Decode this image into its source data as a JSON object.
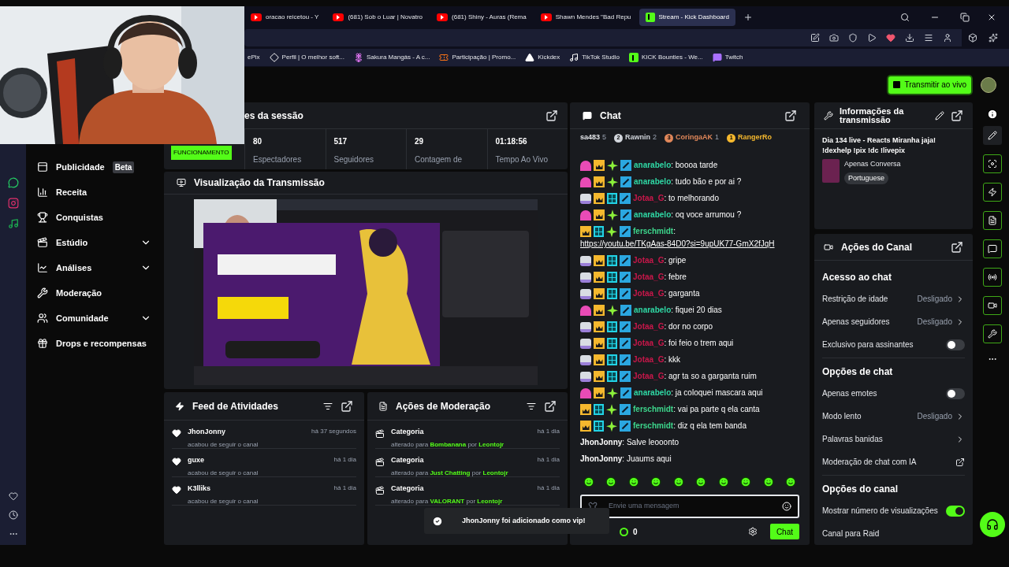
{
  "browser": {
    "tabs": [
      {
        "title": "oracao reicetou - Y",
        "kind": "youtube",
        "selected": false
      },
      {
        "title": "(681) Sob o Luar | Novatro",
        "kind": "youtube",
        "selected": false
      },
      {
        "title": "(681) Shiny - Auras (Rema",
        "kind": "youtube",
        "selected": false
      },
      {
        "title": "Shawn Mendes \"Bad Repu",
        "kind": "youtube",
        "selected": false
      },
      {
        "title": "Stream - Kick Dashboard",
        "kind": "kick",
        "selected": true
      }
    ],
    "bookmarks": [
      {
        "title": "ePix",
        "kind": "none"
      },
      {
        "title": "Perfil | O melhor soft...",
        "kind": "diamond"
      },
      {
        "title": "Sakura Mangás - A c...",
        "kind": "flower"
      },
      {
        "title": "Participação | Promo...",
        "kind": "ticket"
      },
      {
        "title": "Kickdex",
        "kind": "triangle"
      },
      {
        "title": "TikTok Studio",
        "kind": "tiktok"
      },
      {
        "title": "KICK Bounties - We...",
        "kind": "kick"
      },
      {
        "title": "Twitch",
        "kind": "twitch"
      }
    ]
  },
  "header": {
    "go_live_button": "Transmitir ao vivo"
  },
  "sidebar": {
    "items": [
      {
        "label": "Publicidade",
        "badge": "Beta",
        "expandable": false
      },
      {
        "label": "Receita",
        "expandable": false
      },
      {
        "label": "Conquistas",
        "expandable": false
      },
      {
        "label": "Estúdio",
        "expandable": true
      },
      {
        "label": "Análises",
        "expandable": true
      },
      {
        "label": "Moderação",
        "expandable": false
      },
      {
        "label": "Comunidade",
        "expandable": true
      },
      {
        "label": "Drops e recompensas",
        "expandable": false
      }
    ]
  },
  "session_stats": {
    "title": "es da sessão",
    "status_badge": "FUNCIONAMENTO",
    "stats": [
      {
        "value": "80",
        "label": "Espectadores"
      },
      {
        "value": "517",
        "label": "Seguidores"
      },
      {
        "value": "29",
        "label": "Contagem de"
      },
      {
        "value": "01:18:56",
        "label": "Tempo Ao Vivo"
      }
    ]
  },
  "preview": {
    "title": "Visualização da Transmissão"
  },
  "activity_feed": {
    "title": "Feed de Atividades",
    "items": [
      {
        "user": "JhonJonny",
        "action": "acabou de seguir o canal",
        "time": "há 37 segundos"
      },
      {
        "user": "guxe",
        "action": "acabou de seguir o canal",
        "time": "há 1 dia"
      },
      {
        "user": "K3lliks",
        "action": "acabou de seguir o canal",
        "time": "há 1 dia"
      }
    ]
  },
  "moderation_actions": {
    "title": "Ações de Moderação",
    "items": [
      {
        "title": "Categoria",
        "change": "alterado para",
        "category": "Bombanana",
        "by": "por",
        "moderator": "Leontojr",
        "time": "há 1 dia"
      },
      {
        "title": "Categoria",
        "change": "alterado para",
        "category": "Just Chatting",
        "by": "por",
        "moderator": "Leontojr",
        "time": "há 1 dia"
      },
      {
        "title": "Categoria",
        "change": "alterado para",
        "category": "VALORANT",
        "by": "por",
        "moderator": "Leontojr",
        "time": "há 1 dia"
      }
    ]
  },
  "chat": {
    "title": "Chat",
    "leaderboard": [
      {
        "name": "sa483",
        "count": "5"
      },
      {
        "rank": "2",
        "name": "Rawnin",
        "count": "2",
        "color": "#d1d5db"
      },
      {
        "rank": "3",
        "name": "CoringaAK",
        "count": "1",
        "color": "#e0875a"
      },
      {
        "rank": "1",
        "name": "RangerRo",
        "color": "#f5b82e"
      }
    ],
    "messages": [
      {
        "badges": [
          {
            "kind": "sub25"
          },
          {
            "kind": "founder"
          },
          {
            "kind": "vip"
          },
          {
            "kind": "mod"
          }
        ],
        "user": "anarabelo",
        "separator": ":",
        "color": "#2fd9a5",
        "text": "boooa tarde"
      },
      {
        "badges": [
          {
            "kind": "sub25"
          },
          {
            "kind": "founder"
          },
          {
            "kind": "vip"
          },
          {
            "kind": "mod"
          }
        ],
        "user": "anarabelo",
        "separator": ":",
        "color": "#2fd9a5",
        "text": "tudo bão e por ai ?"
      },
      {
        "badges": [
          {
            "kind": "sub22"
          },
          {
            "kind": "founder"
          },
          {
            "kind": "og"
          },
          {
            "kind": "mod"
          }
        ],
        "user": "Jotaa_G",
        "separator": ":",
        "color": "#c8174a",
        "text": "to melhorando"
      },
      {
        "badges": [
          {
            "kind": "sub25"
          },
          {
            "kind": "founder"
          },
          {
            "kind": "vip"
          },
          {
            "kind": "mod"
          }
        ],
        "user": "anarabelo",
        "separator": ":",
        "color": "#2fd9a5",
        "text": "oq voce arrumou ?"
      },
      {
        "badges": [
          {
            "kind": "founder"
          },
          {
            "kind": "og"
          },
          {
            "kind": "vip"
          },
          {
            "kind": "mod"
          }
        ],
        "user": "ferschmidt",
        "separator": ":",
        "color": "#3dd68c",
        "text": "https://youtu.be/TKgAas-84D0?si=9upUK77-GmX2fJqH",
        "kind": "link"
      },
      {
        "badges": [
          {
            "kind": "sub22"
          },
          {
            "kind": "founder"
          },
          {
            "kind": "og"
          },
          {
            "kind": "mod"
          }
        ],
        "user": "Jotaa_G",
        "separator": ":",
        "color": "#c8174a",
        "text": "gripe"
      },
      {
        "badges": [
          {
            "kind": "sub22"
          },
          {
            "kind": "founder"
          },
          {
            "kind": "og"
          },
          {
            "kind": "mod"
          }
        ],
        "user": "Jotaa_G",
        "separator": ":",
        "color": "#c8174a",
        "text": "febre"
      },
      {
        "badges": [
          {
            "kind": "sub22"
          },
          {
            "kind": "founder"
          },
          {
            "kind": "og"
          },
          {
            "kind": "mod"
          }
        ],
        "user": "Jotaa_G",
        "separator": ":",
        "color": "#c8174a",
        "text": "garganta"
      },
      {
        "badges": [
          {
            "kind": "sub25"
          },
          {
            "kind": "founder"
          },
          {
            "kind": "vip"
          },
          {
            "kind": "mod"
          }
        ],
        "user": "anarabelo",
        "separator": ":",
        "color": "#2fd9a5",
        "text": "fiquei 20 dias"
      },
      {
        "badges": [
          {
            "kind": "sub22"
          },
          {
            "kind": "founder"
          },
          {
            "kind": "og"
          },
          {
            "kind": "mod"
          }
        ],
        "user": "Jotaa_G",
        "separator": ":",
        "color": "#c8174a",
        "text": "dor no corpo"
      },
      {
        "badges": [
          {
            "kind": "sub22"
          },
          {
            "kind": "founder"
          },
          {
            "kind": "og"
          },
          {
            "kind": "mod"
          }
        ],
        "user": "Jotaa_G",
        "separator": ":",
        "color": "#c8174a",
        "text": "foi feio o trem aqui"
      },
      {
        "badges": [
          {
            "kind": "sub22"
          },
          {
            "kind": "founder"
          },
          {
            "kind": "og"
          },
          {
            "kind": "mod"
          }
        ],
        "user": "Jotaa_G",
        "separator": ":",
        "color": "#c8174a",
        "text": "kkk"
      },
      {
        "badges": [
          {
            "kind": "sub22"
          },
          {
            "kind": "founder"
          },
          {
            "kind": "og"
          },
          {
            "kind": "mod"
          }
        ],
        "user": "Jotaa_G",
        "separator": ":",
        "color": "#c8174a",
        "text": "agr ta so a garganta ruim"
      },
      {
        "badges": [
          {
            "kind": "sub25"
          },
          {
            "kind": "founder"
          },
          {
            "kind": "vip"
          },
          {
            "kind": "mod"
          }
        ],
        "user": "anarabelo",
        "separator": ":",
        "color": "#2fd9a5",
        "text": "ja coloquei mascara aqui"
      },
      {
        "badges": [
          {
            "kind": "founder"
          },
          {
            "kind": "og"
          },
          {
            "kind": "vip"
          },
          {
            "kind": "mod"
          }
        ],
        "user": "ferschmidt",
        "separator": ":",
        "color": "#3dd68c",
        "text": "vai pa parte q ela canta"
      },
      {
        "badges": [
          {
            "kind": "founder"
          },
          {
            "kind": "og"
          },
          {
            "kind": "vip"
          },
          {
            "kind": "mod"
          }
        ],
        "user": "ferschmidt",
        "separator": ":",
        "color": "#3dd68c",
        "text": "diz q ela tem banda"
      },
      {
        "user": "JhonJonny",
        "separator": ":",
        "color": "#ffffff",
        "text": "Salve leooonto"
      },
      {
        "user": "JhonJonny",
        "separator": ":",
        "color": "#ffffff",
        "text": "Juaums aqui"
      }
    ],
    "input": {
      "placeholder": "Envie uma mensagem"
    },
    "points": "0",
    "send_button": "Chat"
  },
  "stream_info": {
    "title": "Informações da transmissão",
    "stream_title": "Dia 134 live - Reacts Miranha jaja! !dexhelp !pix !dc !livepix",
    "category": "Apenas Conversa",
    "language": "Portuguese"
  },
  "channel_actions": {
    "title": "Ações do Canal",
    "rows": [
      {
        "kind": "section",
        "label": "Acesso ao chat"
      },
      {
        "kind": "value",
        "label": "Restrição de idade",
        "value": "Desligado"
      },
      {
        "kind": "value",
        "label": "Apenas seguidores",
        "value": "Desligado"
      },
      {
        "kind": "toggle",
        "label": "Exclusivo para assinantes",
        "on": false
      },
      {
        "kind": "section",
        "label": "Opções de chat"
      },
      {
        "kind": "toggle",
        "label": "Apenas emotes",
        "on": false
      },
      {
        "kind": "value",
        "label": "Modo lento",
        "value": "Desligado"
      },
      {
        "kind": "link",
        "label": "Palavras banidas"
      },
      {
        "kind": "external",
        "label": "Moderação de chat com IA"
      },
      {
        "kind": "section",
        "label": "Opções do canal"
      },
      {
        "kind": "toggle",
        "label": "Mostrar número de visualizações",
        "on": true
      },
      {
        "kind": "link_plain",
        "label": "Canal para Raid"
      }
    ]
  },
  "toast": {
    "text": "JhonJonny foi adicionado como vip!"
  }
}
